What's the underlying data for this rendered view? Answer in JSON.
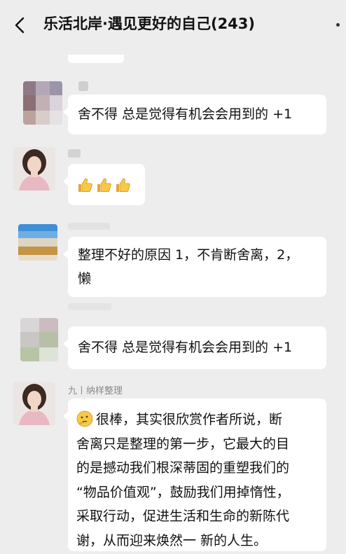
{
  "header": {
    "back_icon": "chevron-left-icon",
    "title": "乐活北岸·遇见更好的自己(243)",
    "more_icon": "more-dots-icon"
  },
  "messages": [
    {
      "text": "舍不得 总是觉得有机会会用到的 +1"
    },
    {
      "emoji": [
        "thumbs-up-icon",
        "thumbs-up-icon",
        "thumbs-up-icon"
      ]
    },
    {
      "line1": "整理不好的原因 1，不肯断舍离，2，",
      "line2": "懒"
    },
    {
      "text": "舍不得 总是觉得有机会会用到的 +1"
    },
    {
      "sender": "九丨纳样整理",
      "emoji": "thinking-face-icon",
      "lines": [
        "很棒，其实很欣赏作者所说，断",
        "舍离只是整理的第一步，它最大的目",
        "的是撼动我们根深蒂固的重塑我们的",
        "“物品价值观”，鼓励我们用掉惰性，",
        "采取行动，促进生活和生命的新陈代",
        "谢，从而迎来焕然一 新的人生。"
      ]
    }
  ]
}
